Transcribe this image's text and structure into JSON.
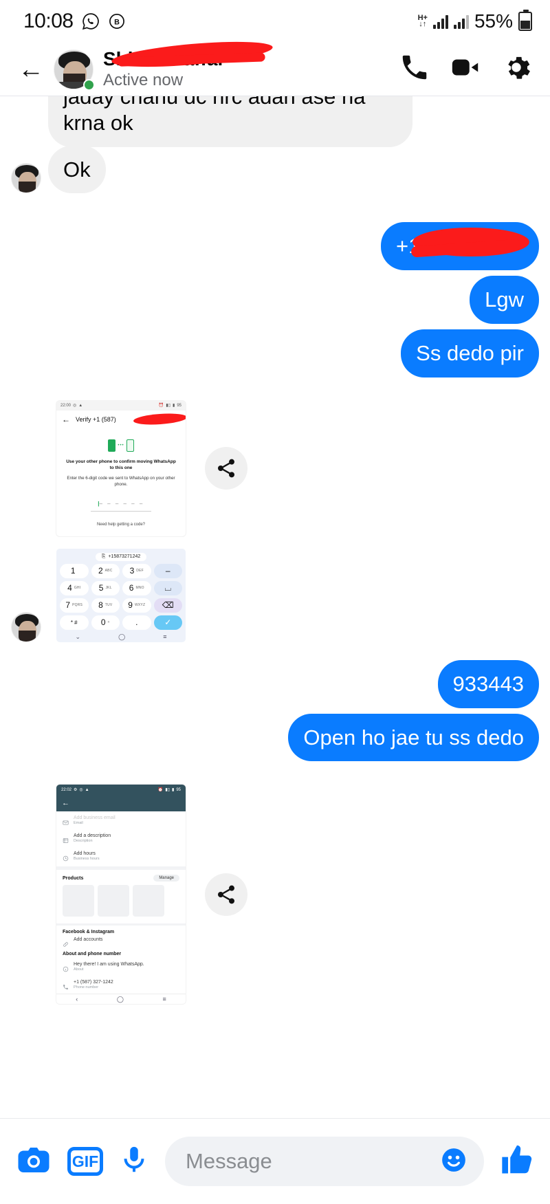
{
  "status_bar": {
    "clock": "10:08",
    "icons": [
      "whatsapp-icon",
      "business-icon"
    ],
    "network_type": "H+",
    "battery_text": "55%",
    "battery_level": 55
  },
  "header": {
    "back_icon": "back-arrow-icon",
    "contact_name": "Shhh Ghaffar",
    "name_redacted": true,
    "status": "Active now",
    "online": true,
    "actions": [
      "call-icon",
      "video-icon",
      "settings-icon"
    ]
  },
  "messages": [
    {
      "id": "m1",
      "side": "in",
      "text": "jaday chahu dc hrc adan ase na krna ok",
      "clipped_top": true,
      "avatar": false
    },
    {
      "id": "m2",
      "side": "in",
      "text": "Ok",
      "avatar": true
    },
    {
      "id": "m3",
      "side": "out",
      "text": "+158",
      "redacted": true
    },
    {
      "id": "m4",
      "side": "out",
      "text": "Lgw"
    },
    {
      "id": "m5",
      "side": "out",
      "text": "Ss dedo pir"
    },
    {
      "id": "m6",
      "side": "out",
      "text": "933443"
    },
    {
      "id": "m7",
      "side": "out",
      "text": "Open ho jae tu ss dedo"
    }
  ],
  "attachment_verify": {
    "share_icon": "share-icon",
    "status_bar": {
      "time": "22:00",
      "battery": "95"
    },
    "app_bar": {
      "back_icon": "back-arrow-icon",
      "title": "Verify +1 (587)",
      "menu_icon": "overflow-menu-icon",
      "redacted": true
    },
    "illustration": "two-phones-icon",
    "heading": "Use your other phone to confirm moving WhatsApp to this one",
    "subtext": "Enter the 6-digit code we sent to WhatsApp on your other phone.",
    "code_placeholder": "– – –   – – –",
    "help_link": "Need help getting a code?"
  },
  "attachment_dialpad": {
    "number": "+15873271242",
    "copy_icon": "copy-icon",
    "keys": [
      {
        "digit": "1",
        "sub": ""
      },
      {
        "digit": "2",
        "sub": "ABC"
      },
      {
        "digit": "3",
        "sub": "DEF"
      },
      {
        "digit": "–",
        "sub": "",
        "style": "side"
      },
      {
        "digit": "4",
        "sub": "GHI"
      },
      {
        "digit": "5",
        "sub": "JKL"
      },
      {
        "digit": "6",
        "sub": "MNO"
      },
      {
        "digit": "⌴",
        "sub": "",
        "style": "side"
      },
      {
        "digit": "7",
        "sub": "PQRS"
      },
      {
        "digit": "8",
        "sub": "TUV"
      },
      {
        "digit": "9",
        "sub": "WXYZ"
      },
      {
        "digit": "⌫",
        "sub": "",
        "style": "del"
      },
      {
        "digit": "* #",
        "sub": ""
      },
      {
        "digit": "0",
        "sub": "+"
      },
      {
        "digit": ".",
        "sub": ""
      },
      {
        "digit": "✓",
        "sub": "",
        "style": "ok"
      }
    ],
    "nav": [
      "chevron-down-icon",
      "home-circle-icon",
      "recents-icon"
    ]
  },
  "attachment_business": {
    "share_icon": "share-icon",
    "status_bar": {
      "time": "22:02",
      "battery": "95"
    },
    "back_icon": "back-arrow-icon",
    "items": [
      {
        "icon": "email-icon",
        "main": "Add business email",
        "sub": "Email",
        "clipped": true
      },
      {
        "icon": "description-icon",
        "main": "Add a description",
        "sub": "Description"
      },
      {
        "icon": "clock-icon",
        "main": "Add hours",
        "sub": "Business hours"
      }
    ],
    "products": {
      "title": "Products",
      "manage_label": "Manage",
      "count": 3
    },
    "social": {
      "title": "Facebook & Instagram",
      "icon": "link-icon",
      "label": "Add accounts"
    },
    "about_title": "About and phone number",
    "about": [
      {
        "icon": "info-icon",
        "main": "Hey there! I am using WhatsApp.",
        "sub": "About"
      },
      {
        "icon": "phone-icon",
        "main": "+1 (587) 327-1242",
        "sub": "Phone number"
      }
    ],
    "nav": [
      "back-icon",
      "home-circle-icon",
      "recents-icon"
    ]
  },
  "composer": {
    "camera_icon": "camera-icon",
    "gif_label": "GIF",
    "mic_icon": "microphone-icon",
    "placeholder": "Message",
    "emoji_icon": "smiley-icon",
    "like_icon": "thumbs-up-icon"
  },
  "colors": {
    "accent": "#0a7cff",
    "incoming_bubble": "#f0f0f0",
    "online": "#31a24c",
    "redaction": "#fb1b1b",
    "business_bar": "#33525e"
  }
}
